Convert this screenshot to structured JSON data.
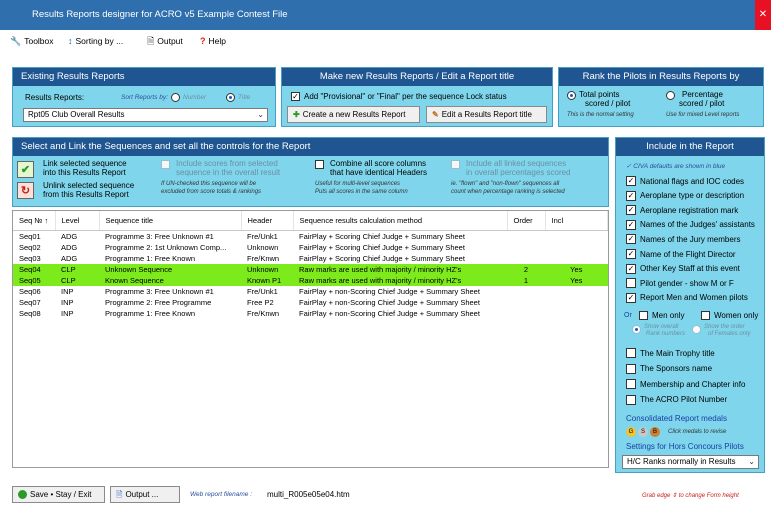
{
  "window": {
    "title": "Results Reports designer for ACRO v5 Example Contest File",
    "close_glyph": "✕"
  },
  "menu": {
    "items": [
      {
        "label": "Toolbox",
        "icon": "wrench-icon",
        "glyph": "🔧"
      },
      {
        "label": "Sorting by ...",
        "icon": "sort-icon",
        "glyph": "↕"
      },
      {
        "label": "Output",
        "icon": "document-icon",
        "glyph": "🗎"
      },
      {
        "label": "Help",
        "icon": "question-icon",
        "glyph": "?"
      }
    ]
  },
  "existing": {
    "header": "Existing Results Reports",
    "reports_label": "Results Reports:",
    "sort_label": "Sort Reports by:",
    "sort_number": "Number",
    "sort_title": "Title",
    "selected_report": "Rpt05 Club Overall Results"
  },
  "make_new": {
    "header": "Make new Results Reports / Edit a Report title",
    "provisional_label": "Add \"Provisional\" or \"Final\" per the sequence Lock status",
    "create_button": "Create a new Results Report",
    "edit_button": "Edit a Results Report title",
    "create_glyph": "✚",
    "edit_glyph": "✎"
  },
  "rank": {
    "header": "Rank the Pilots in Results Reports by",
    "total_line1": "Total points",
    "total_line2": "scored / pilot",
    "percentage_line1": "Percentage",
    "percentage_line2": "scored / pilot",
    "hint_total": "This is the normal setting",
    "hint_percentage": "Use for mixed Level reports"
  },
  "select_link": {
    "header": "Select and Link the Sequences and set all the controls for the Report",
    "link_label_1": "Link selected sequence",
    "link_label_2": "into this Results Report",
    "unlink_label_1": "Unlink selected sequence",
    "unlink_label_2": "from this Results Report",
    "link_glyph": "✔",
    "unlink_glyph": "↻",
    "include_scores_1": "Include scores from selected",
    "include_scores_2": "sequence in the overall result",
    "include_scores_hint_1": "If UN-checked this sequence will be",
    "include_scores_hint_2": "excluded from score totals & rankings",
    "combine_1": "Combine all score columns",
    "combine_2": "that have identical Headers",
    "combine_hint_1": "Useful for multi-level sequences",
    "combine_hint_2": "Puts all scores in the same column",
    "include_linked_1": "Include all linked sequences",
    "include_linked_2": "in overall percentages scored",
    "include_linked_hint_1": "ie. \"flown\" and \"non-flown\" sequences all",
    "include_linked_hint_2": "count when percentage ranking is selected"
  },
  "table": {
    "columns": [
      "Seq № ↑",
      "Level",
      "Sequence title",
      "Header",
      "Sequence results calculation method",
      "Order",
      "Incl"
    ],
    "rows": [
      {
        "seq": "Seq01",
        "level": "ADG",
        "title": "Programme 3: Free Unknown #1",
        "header": "Fre/Unk1",
        "method": "FairPlay + Scoring Chief Judge + Summary Sheet",
        "order": "",
        "incl": "",
        "hl": false
      },
      {
        "seq": "Seq02",
        "level": "ADG",
        "title": "Programme 2: 1st Unknown Comp...",
        "header": "Unknown",
        "method": "FairPlay + Scoring Chief Judge + Summary Sheet",
        "order": "",
        "incl": "",
        "hl": false
      },
      {
        "seq": "Seq03",
        "level": "ADG",
        "title": "Programme 1: Free Known",
        "header": "Fre/Knwn",
        "method": "FairPlay + Scoring Chief Judge + Summary Sheet",
        "order": "",
        "incl": "",
        "hl": false
      },
      {
        "seq": "Seq04",
        "level": "CLP",
        "title": "Unknown Sequence",
        "header": "Unknown",
        "method": "Raw marks are used with majority / minority HZ's",
        "order": "2",
        "incl": "Yes",
        "hl": true
      },
      {
        "seq": "Seq05",
        "level": "CLP",
        "title": "Known Sequence",
        "header": "Known P1",
        "method": "Raw marks are used with majority / minority HZ's",
        "order": "1",
        "incl": "Yes",
        "hl": true
      },
      {
        "seq": "Seq06",
        "level": "INP",
        "title": "Programme 3: Free Unknown #1",
        "header": "Fre/Unk1",
        "method": "FairPlay + non-Scoring Chief Judge + Summary Sheet",
        "order": "",
        "incl": "",
        "hl": false
      },
      {
        "seq": "Seq07",
        "level": "INP",
        "title": "Programme 2: Free Programme",
        "header": "Free P2",
        "method": "FairPlay + non-Scoring Chief Judge + Summary Sheet",
        "order": "",
        "incl": "",
        "hl": false
      },
      {
        "seq": "Seq08",
        "level": "INP",
        "title": "Programme 1: Free Known",
        "header": "Fre/Knwn",
        "method": "FairPlay + non-Scoring Chief Judge + Summary Sheet",
        "order": "",
        "incl": "",
        "hl": false
      }
    ]
  },
  "include": {
    "header": "Include in the Report",
    "civa_note": "CIVA defaults are shown in blue",
    "civa_glyph": "✓",
    "items": [
      {
        "label": "National flags and IOC codes",
        "checked": true
      },
      {
        "label": "Aeroplane type or description",
        "checked": true
      },
      {
        "label": "Aeroplane registration mark",
        "checked": true
      },
      {
        "label": "Names of the Judges' assistants",
        "checked": true
      },
      {
        "label": "Names of the Jury members",
        "checked": true
      },
      {
        "label": "Name of the Flight Director",
        "checked": true
      },
      {
        "label": "Other Key Staff at this event",
        "checked": true
      },
      {
        "label": "Pilot gender - show M or F",
        "checked": false
      },
      {
        "label": "Report Men and Women pilots",
        "checked": true
      }
    ],
    "or_label": "Or",
    "men_only": "Men only",
    "women_only": "Women only",
    "show_overall_1": "Show overall",
    "show_overall_2": "Rank numbers",
    "show_order_1": "Show the order",
    "show_order_2": "of Females only",
    "items2": [
      {
        "label": "The Main Trophy title",
        "checked": false
      },
      {
        "label": "The Sponsors name",
        "checked": false
      },
      {
        "label": "Membership and Chapter info",
        "checked": false
      },
      {
        "label": "The ACRO Pilot Number",
        "checked": false
      }
    ],
    "medals_label": "Consolidated Report medals",
    "medals": [
      "G",
      "S",
      "B"
    ],
    "medals_hint": "Click medals to revise",
    "hors_label": "Settings for Hors Concours Pilots",
    "hors_selected": "H/C Ranks normally in Results"
  },
  "status": {
    "save_label": "Save • Stay / Exit",
    "output_label": "Output ...",
    "filename_label": "Web report filename :",
    "filename_value": "multi_R005e05e04.htm",
    "grab_hint": "Grab edge ⇕ to change Form height"
  },
  "colors": {
    "panel_bg": "#7fd6ec",
    "panel_header": "#1f5590",
    "highlight_row": "#7dea1b",
    "titlebar": "#2f6fad"
  }
}
